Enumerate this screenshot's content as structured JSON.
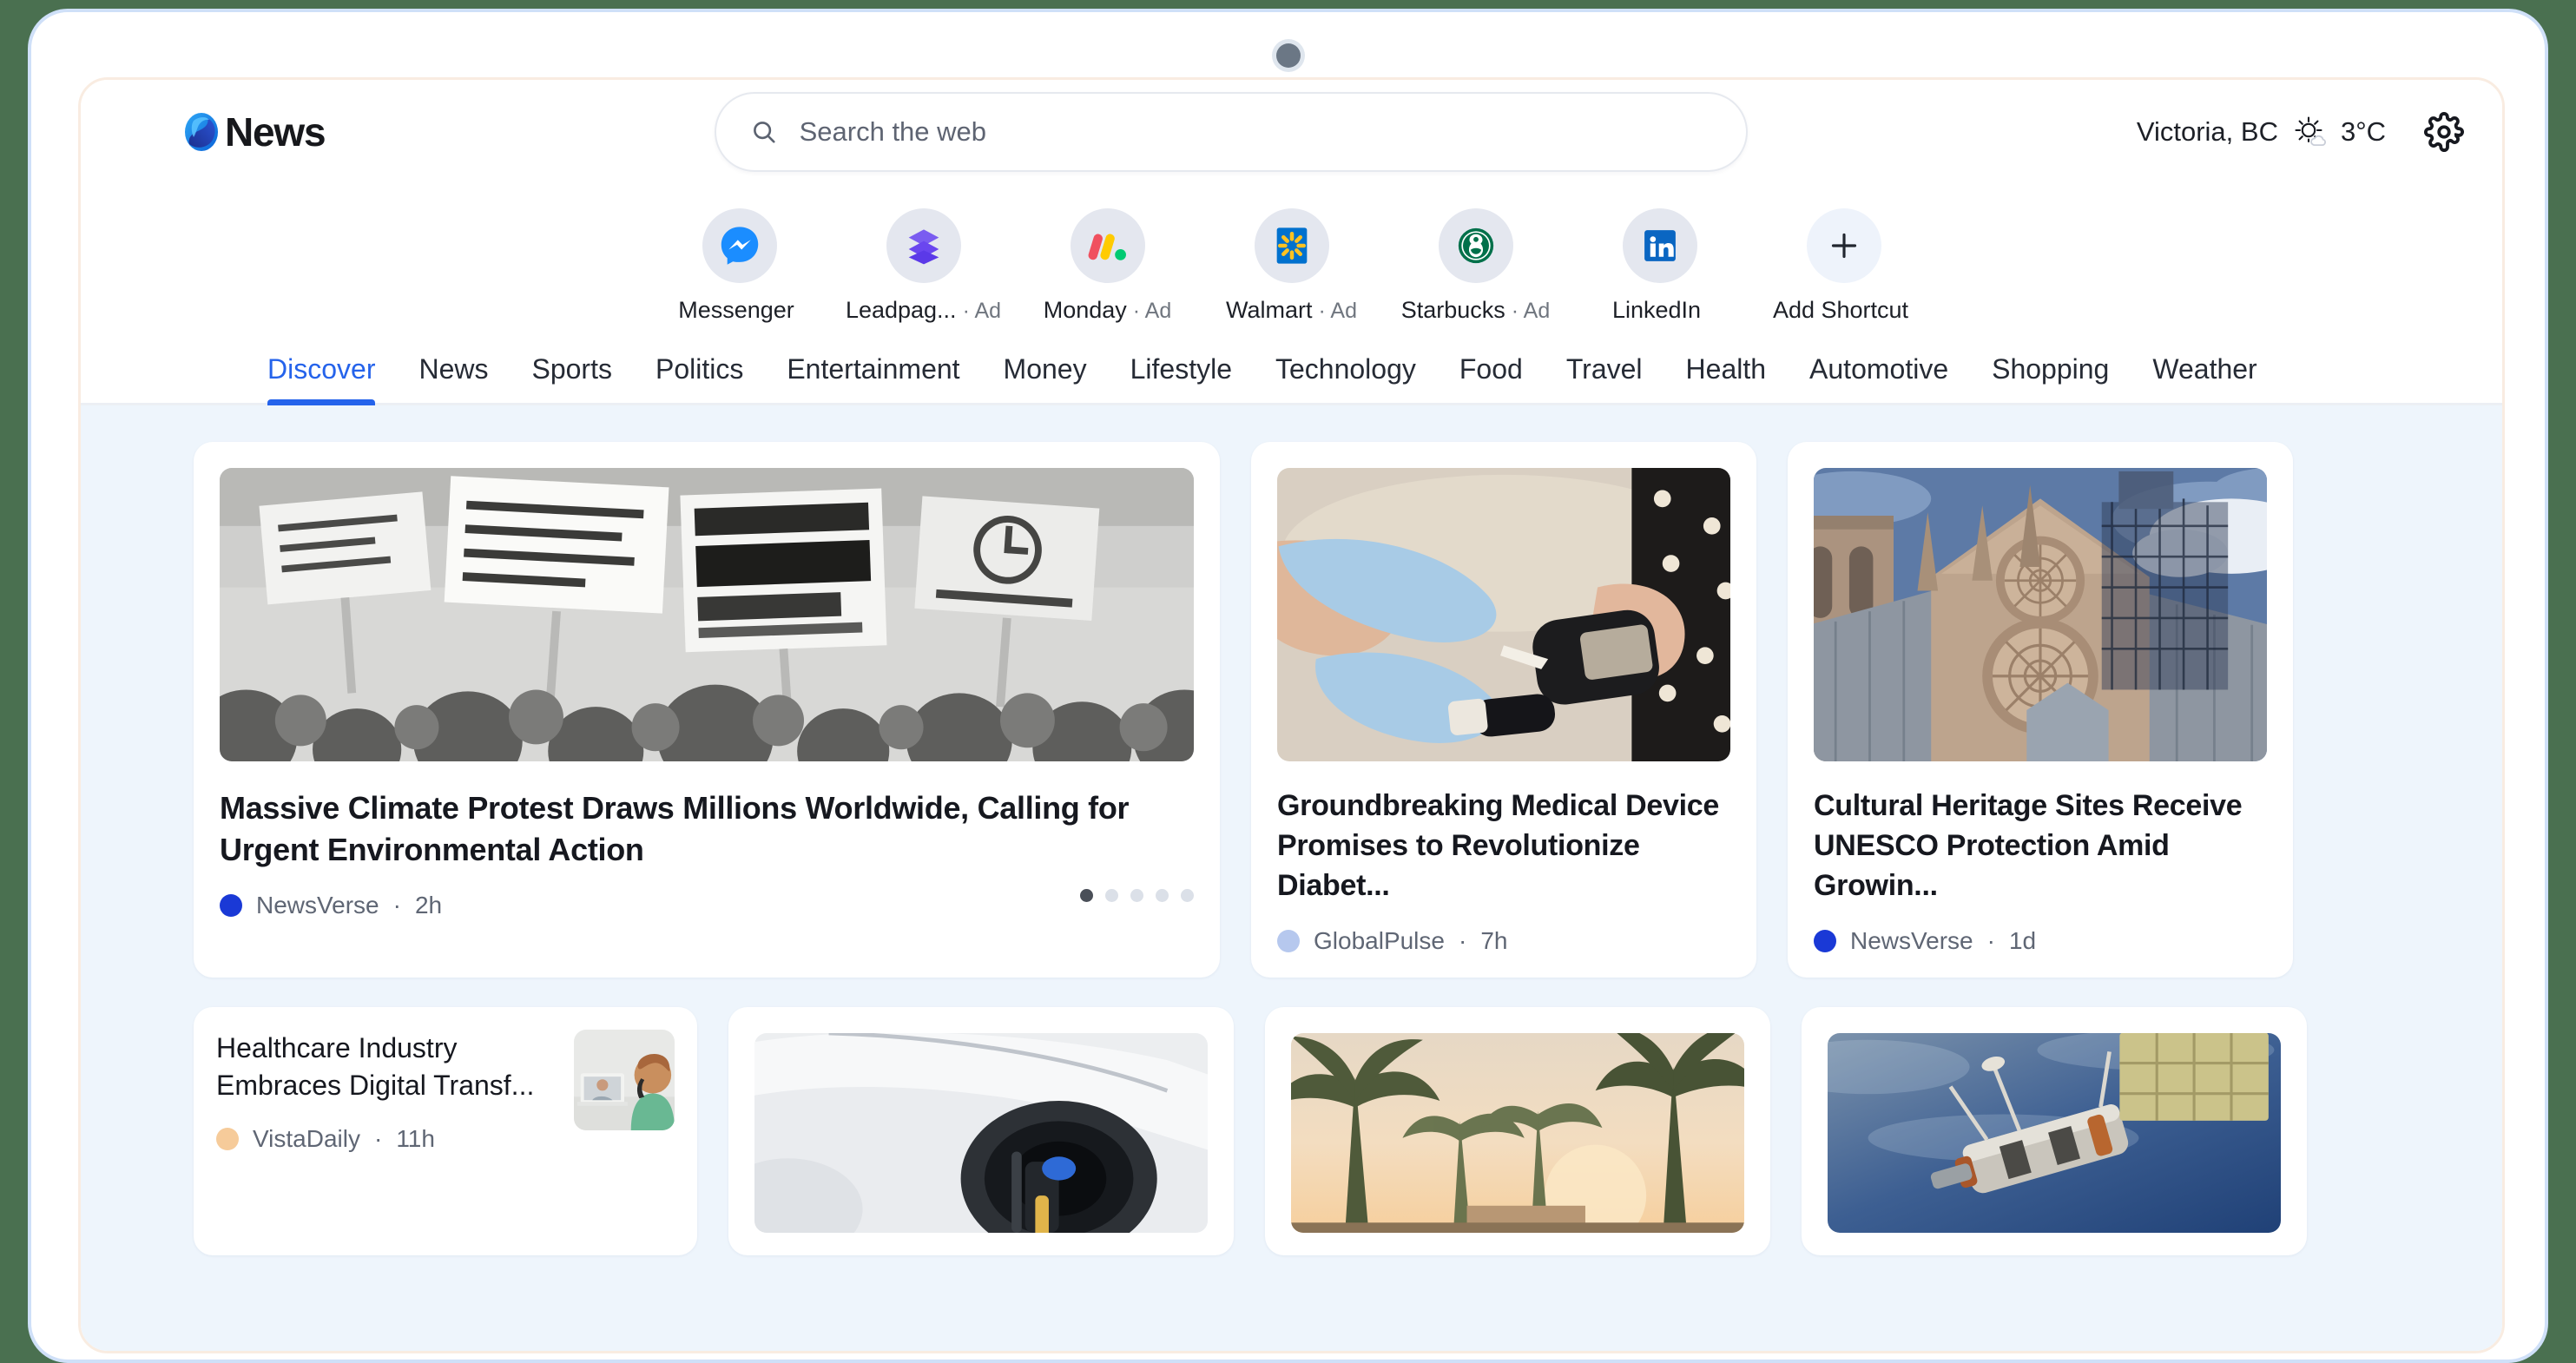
{
  "app": {
    "brand_name": "News",
    "brand_logo_icon": "edge-swoosh-logo"
  },
  "search": {
    "placeholder": "Search the web",
    "value": "",
    "icon": "search-icon"
  },
  "weather": {
    "location": "Victoria, BC",
    "temperature": "3°C",
    "icon": "sun-with-cloud-icon"
  },
  "settings": {
    "icon": "gear-icon",
    "label": "Settings"
  },
  "camera": {
    "icon": "webcam-dot-icon"
  },
  "shortcuts": [
    {
      "label": "Messenger",
      "ad": "",
      "icon": "messenger-icon"
    },
    {
      "label": "Leadpag...",
      "ad": "· Ad",
      "icon": "leadpages-layers-icon"
    },
    {
      "label": "Monday",
      "ad": "· Ad",
      "icon": "monday-icon"
    },
    {
      "label": "Walmart",
      "ad": "· Ad",
      "icon": "walmart-spark-icon"
    },
    {
      "label": "Starbucks",
      "ad": "· Ad",
      "icon": "starbucks-siren-icon"
    },
    {
      "label": "LinkedIn",
      "ad": "",
      "icon": "linkedin-icon"
    },
    {
      "label": "Add Shortcut",
      "ad": "",
      "icon": "plus-icon"
    }
  ],
  "nav": {
    "active": "Discover",
    "items": [
      "Discover",
      "News",
      "Sports",
      "Politics",
      "Entertainment",
      "Money",
      "Lifestyle",
      "Technology",
      "Food",
      "Travel",
      "Health",
      "Automotive",
      "Shopping",
      "Weather"
    ]
  },
  "feed": {
    "hero": {
      "headline": "Massive Climate Protest Draws Millions Worldwide, Calling for Urgent Environmental Action",
      "source": "NewsVerse",
      "time": "2h",
      "separator": "·",
      "source_dot_color": "#1a39d6",
      "image_alt": "black-and-white photo of climate protest crowd holding signs",
      "carousel": {
        "total": 5,
        "active_index": 0
      }
    },
    "top_cards": [
      {
        "headline": "Groundbreaking Medical Device Promises to Revolutionize Diabet...",
        "source": "GlobalPulse",
        "time": "7h",
        "separator": "·",
        "source_dot_color": "#b6c8ee",
        "image_alt": "gloved hands using a blood glucose meter on a patient's finger"
      },
      {
        "headline": "Cultural Heritage Sites Receive UNESCO Protection Amid Growin...",
        "source": "NewsVerse",
        "time": "1d",
        "separator": "·",
        "source_dot_color": "#1a39d6",
        "image_alt": "Notre-Dame cathedral with restoration scaffolding against blue sky"
      }
    ],
    "bottom_cards": [
      {
        "headline": "Healthcare Industry Embraces Digital Transf...",
        "source": "VistaDaily",
        "time": "11h",
        "separator": "·",
        "source_dot_color": "#f6cb9a",
        "image_alt": "healthcare worker on a video call with a laptop"
      },
      {
        "image_alt": "white electric vehicle being charged, close up of charge port"
      },
      {
        "image_alt": "palm trees silhouetted against a warm sunset sky"
      },
      {
        "image_alt": "satellite with solar panels orbiting above the blue ocean"
      }
    ]
  },
  "colors": {
    "accent": "#2563eb",
    "desktop_background": "#4a7050",
    "window_border": "#cfe0f8",
    "card_border": "#f9ece1",
    "feed_background": "#eef5fc"
  }
}
